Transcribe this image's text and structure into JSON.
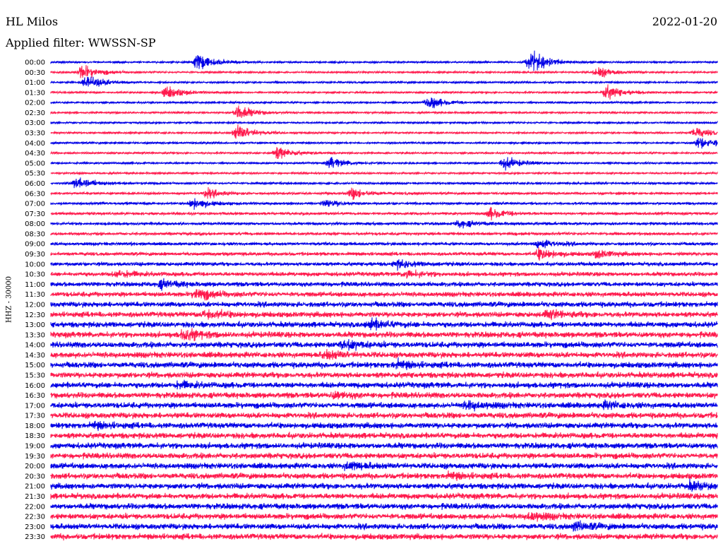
{
  "header": {
    "station": "HL Milos",
    "date": "2022-01-20",
    "filter": "Applied filter: WWSSN-SP"
  },
  "chart_data": {
    "type": "line",
    "ylabel": "HHZ - 30000",
    "colors": [
      "#0000e6",
      "#ff1a4d"
    ],
    "y_tick_labels": [
      "00:00",
      "00:30",
      "01:00",
      "01:30",
      "02:00",
      "02:30",
      "03:00",
      "03:30",
      "04:00",
      "04:30",
      "05:00",
      "05:30",
      "06:00",
      "06:30",
      "07:00",
      "07:30",
      "08:00",
      "08:30",
      "09:00",
      "09:30",
      "10:00",
      "10:30",
      "11:00",
      "11:30",
      "12:00",
      "12:30",
      "13:00",
      "13:30",
      "14:00",
      "14:30",
      "15:00",
      "15:30",
      "16:00",
      "16:30",
      "17:00",
      "17:30",
      "18:00",
      "18:30",
      "19:00",
      "19:30",
      "20:00",
      "20:30",
      "21:00",
      "21:30",
      "22:00",
      "22:30",
      "23:00",
      "23:30"
    ],
    "x_range_minutes": [
      0,
      15
    ],
    "noise_level": [
      1,
      1,
      1,
      1,
      1,
      1,
      1,
      1,
      1,
      1,
      1,
      1,
      1.2,
      1.3,
      1.4,
      1.5,
      1.6,
      1.7,
      1.8,
      2,
      2.2,
      2.4,
      2.6,
      2.8,
      3,
      3.1,
      3.2,
      3.3,
      3.3,
      3.3,
      3.3,
      3.3,
      3.3,
      3.3,
      3.3,
      3.3,
      3.3,
      3.3,
      3.3,
      3.3,
      3.3,
      3.3,
      3.3,
      3.3,
      3.3,
      3.3,
      3.3,
      3.3
    ],
    "events": [
      {
        "trace": 0,
        "minute": 3.3,
        "amplitude": 10
      },
      {
        "trace": 0,
        "minute": 10.8,
        "amplitude": 14
      },
      {
        "trace": 1,
        "minute": 0.7,
        "amplitude": 8
      },
      {
        "trace": 1,
        "minute": 12.3,
        "amplitude": 6
      },
      {
        "trace": 2,
        "minute": 0.8,
        "amplitude": 9
      },
      {
        "trace": 3,
        "minute": 2.6,
        "amplitude": 7
      },
      {
        "trace": 3,
        "minute": 12.5,
        "amplitude": 8
      },
      {
        "trace": 4,
        "minute": 8.5,
        "amplitude": 7
      },
      {
        "trace": 5,
        "minute": 4.2,
        "amplitude": 8
      },
      {
        "trace": 7,
        "minute": 4.2,
        "amplitude": 9
      },
      {
        "trace": 7,
        "minute": 14.5,
        "amplitude": 6
      },
      {
        "trace": 8,
        "minute": 14.6,
        "amplitude": 7
      },
      {
        "trace": 9,
        "minute": 5.1,
        "amplitude": 7
      },
      {
        "trace": 10,
        "minute": 6.3,
        "amplitude": 6
      },
      {
        "trace": 10,
        "minute": 10.2,
        "amplitude": 7
      },
      {
        "trace": 12,
        "minute": 0.6,
        "amplitude": 7
      },
      {
        "trace": 13,
        "minute": 6.8,
        "amplitude": 6
      },
      {
        "trace": 13,
        "minute": 3.5,
        "amplitude": 5
      },
      {
        "trace": 14,
        "minute": 3.2,
        "amplitude": 6
      },
      {
        "trace": 14,
        "minute": 6.2,
        "amplitude": 4
      },
      {
        "trace": 15,
        "minute": 9.9,
        "amplitude": 6
      },
      {
        "trace": 16,
        "minute": 9.2,
        "amplitude": 4
      },
      {
        "trace": 18,
        "minute": 11.0,
        "amplitude": 5
      },
      {
        "trace": 19,
        "minute": 11.0,
        "amplitude": 6
      },
      {
        "trace": 19,
        "minute": 12.3,
        "amplitude": 4
      },
      {
        "trace": 20,
        "minute": 7.8,
        "amplitude": 4
      },
      {
        "trace": 21,
        "minute": 1.5,
        "amplitude": 4
      },
      {
        "trace": 21,
        "minute": 8.0,
        "amplitude": 4
      },
      {
        "trace": 22,
        "minute": 2.5,
        "amplitude": 4
      },
      {
        "trace": 23,
        "minute": 3.3,
        "amplitude": 6
      },
      {
        "trace": 25,
        "minute": 3.5,
        "amplitude": 5
      },
      {
        "trace": 25,
        "minute": 11.2,
        "amplitude": 4
      },
      {
        "trace": 26,
        "minute": 7.2,
        "amplitude": 5
      },
      {
        "trace": 27,
        "minute": 3.0,
        "amplitude": 6
      },
      {
        "trace": 28,
        "minute": 6.6,
        "amplitude": 5
      },
      {
        "trace": 29,
        "minute": 6.2,
        "amplitude": 4
      },
      {
        "trace": 30,
        "minute": 7.8,
        "amplitude": 4
      },
      {
        "trace": 32,
        "minute": 2.9,
        "amplitude": 3
      },
      {
        "trace": 33,
        "minute": 6.4,
        "amplitude": 3
      },
      {
        "trace": 34,
        "minute": 9.4,
        "amplitude": 4
      },
      {
        "trace": 34,
        "minute": 12.5,
        "amplitude": 3
      },
      {
        "trace": 36,
        "minute": 1.0,
        "amplitude": 3
      },
      {
        "trace": 40,
        "minute": 6.7,
        "amplitude": 4
      },
      {
        "trace": 41,
        "minute": 9.0,
        "amplitude": 3
      },
      {
        "trace": 42,
        "minute": 14.4,
        "amplitude": 4
      },
      {
        "trace": 45,
        "minute": 10.8,
        "amplitude": 4
      },
      {
        "trace": 46,
        "minute": 11.8,
        "amplitude": 4
      }
    ]
  }
}
